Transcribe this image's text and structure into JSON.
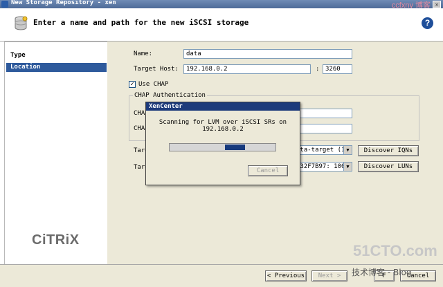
{
  "window": {
    "title": "New Storage Repository - xen",
    "close_glyph": "✕",
    "watermark_top": "ccfxny 博客"
  },
  "header": {
    "heading": "Enter a name and path for the new iSCSI storage",
    "help_glyph": "?"
  },
  "sidebar": {
    "items": [
      {
        "label": "Type",
        "selected": false
      },
      {
        "label": "Location",
        "selected": true
      }
    ]
  },
  "brand": {
    "logo_text": "CiTRiX"
  },
  "form": {
    "name_label": "Name:",
    "name_value": "data",
    "target_host_label": "Target Host:",
    "target_host_value": "192.168.0.2",
    "port_separator": ":",
    "port_value": "3260",
    "use_chap_label": "Use CHAP",
    "use_chap_checked": true,
    "check_glyph": "✓",
    "chap_group_label": "CHAP Authentication",
    "chap_user_label": "CHAP",
    "chap_secret_label": "CHAP",
    "target_iqn_label": "Targ",
    "target_iqn_value": "ata-target (19",
    "target_lun_label": "Targ",
    "target_lun_value": "632F7B97: 100",
    "discover_iqns": "Discover IQNs",
    "discover_luns": "Discover LUNs"
  },
  "buttons": {
    "previous": "< Previous",
    "next": "Next >",
    "cancel": "Cancel",
    "finish_partial": "F"
  },
  "modal": {
    "title": "XenCenter",
    "message_line1": "Scanning for LVM over iSCSI SRs on",
    "message_line2": "192.168.0.2",
    "progress_start": 0.52,
    "progress_end": 0.71,
    "cancel": "Cancel"
  },
  "watermarks": {
    "site": "51CTO.com",
    "blog": "技术博客 - Blog"
  },
  "colors": {
    "selection": "#2e5a9c",
    "modal_title": "#1d3a7b",
    "progress": "#173a7d",
    "help": "#1f4f9a"
  }
}
